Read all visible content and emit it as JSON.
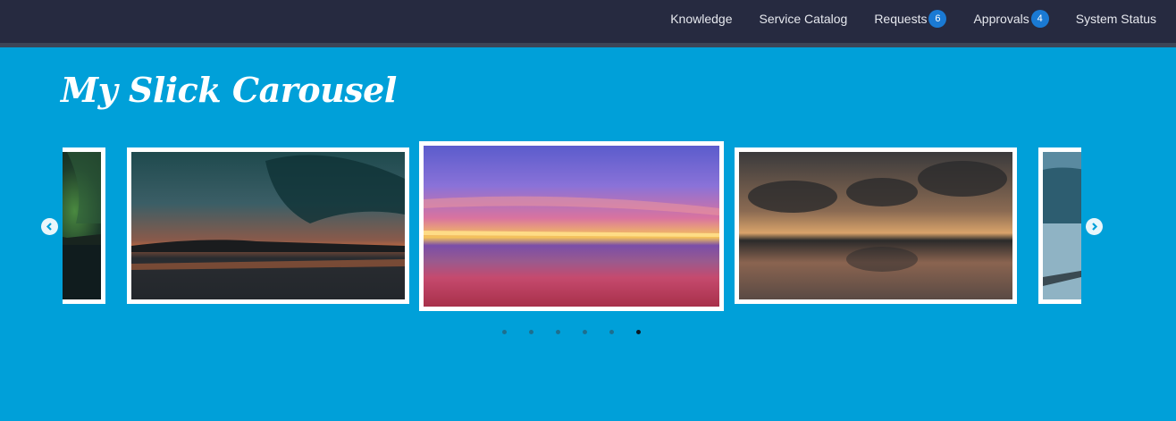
{
  "nav": {
    "items": [
      {
        "label": "Knowledge"
      },
      {
        "label": "Service Catalog"
      },
      {
        "label": "Requests",
        "badge": "6"
      },
      {
        "label": "Approvals",
        "badge": "4"
      },
      {
        "label": "System Status"
      }
    ]
  },
  "page": {
    "title": "My Slick Carousel"
  },
  "carousel": {
    "prev_icon": "chevron-left-icon",
    "next_icon": "chevron-right-icon",
    "slides": [
      {
        "description": "aurora"
      },
      {
        "description": "sunset-lake"
      },
      {
        "description": "pink-beach-sunset"
      },
      {
        "description": "cloudy-reflection"
      },
      {
        "description": "glacier-lake"
      }
    ],
    "dots_count": 6,
    "active_dot": 6
  },
  "colors": {
    "background": "#00a0d9",
    "topbar": "#262a40",
    "badge": "#1a7ad4"
  }
}
